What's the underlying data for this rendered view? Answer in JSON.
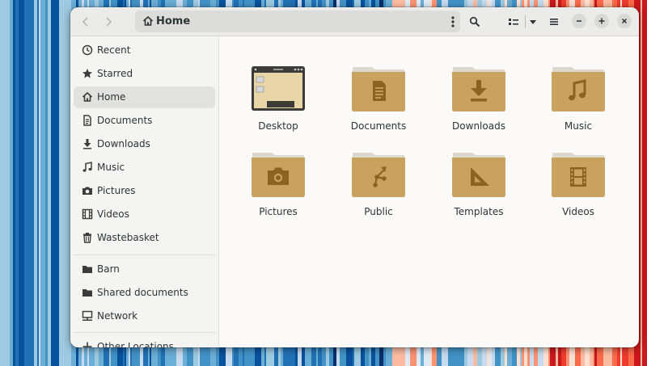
{
  "window": {
    "location": "Home",
    "icons": {
      "back": "go-back-icon",
      "forward": "go-forward-icon",
      "location_home": "home-icon",
      "path_menu": "kebab-menu-icon",
      "search": "search-icon",
      "view_mode": "list-view-icon",
      "view_options": "chevron-down-icon",
      "main_menu": "hamburger-menu-icon",
      "minimize": "minimize-icon",
      "maximize": "maximize-icon",
      "close": "close-icon"
    }
  },
  "sidebar": {
    "items": [
      {
        "label": "Recent",
        "icon": "clock-icon"
      },
      {
        "label": "Starred",
        "icon": "star-icon"
      },
      {
        "label": "Home",
        "icon": "home-icon",
        "active": true
      },
      {
        "label": "Documents",
        "icon": "document-icon"
      },
      {
        "label": "Downloads",
        "icon": "download-icon"
      },
      {
        "label": "Music",
        "icon": "music-note-icon"
      },
      {
        "label": "Pictures",
        "icon": "camera-icon"
      },
      {
        "label": "Videos",
        "icon": "film-icon"
      },
      {
        "label": "Wastebasket",
        "icon": "trash-icon"
      }
    ],
    "bookmarks": [
      {
        "label": "Barn",
        "icon": "folder-icon"
      },
      {
        "label": "Shared documents",
        "icon": "folder-icon"
      },
      {
        "label": "Network",
        "icon": "network-icon"
      }
    ],
    "other_locations": {
      "label": "Other Locations",
      "icon": "plus-icon"
    }
  },
  "files": [
    {
      "name": "Desktop",
      "icon": "desktop-folder-icon"
    },
    {
      "name": "Documents",
      "icon": "documents-folder-icon"
    },
    {
      "name": "Downloads",
      "icon": "downloads-folder-icon"
    },
    {
      "name": "Music",
      "icon": "music-folder-icon"
    },
    {
      "name": "Pictures",
      "icon": "pictures-folder-icon"
    },
    {
      "name": "Public",
      "icon": "public-folder-icon"
    },
    {
      "name": "Templates",
      "icon": "templates-folder-icon"
    },
    {
      "name": "Videos",
      "icon": "videos-folder-icon"
    }
  ],
  "colors": {
    "folder_body": "#c9a25f",
    "folder_tab": "#ddd8ce",
    "folder_glyph": "#8a6420",
    "text": "#2e3436",
    "sidebar_bg": "#f4f4f3",
    "content_bg": "#fbfaf9"
  }
}
